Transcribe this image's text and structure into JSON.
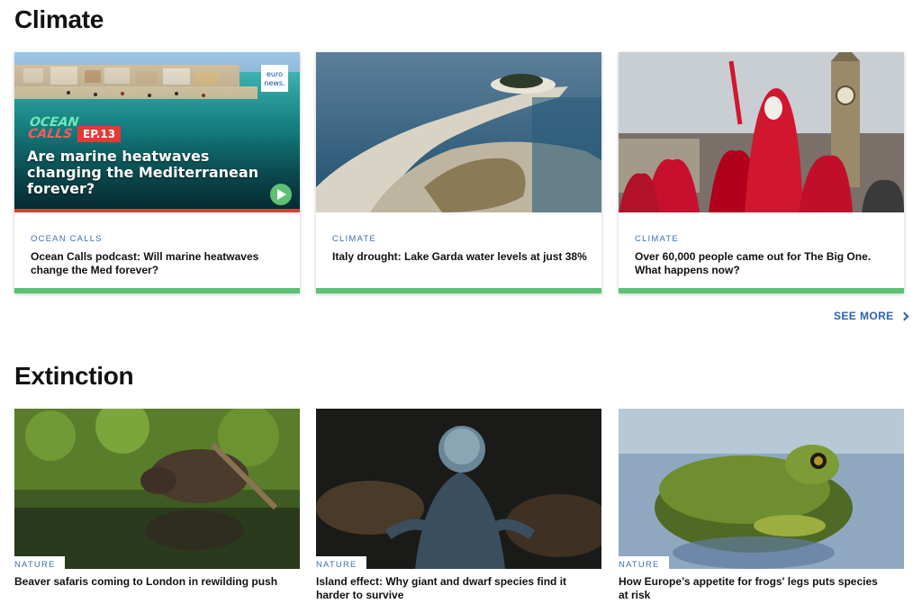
{
  "sections": {
    "climate": {
      "title": "Climate",
      "see_more": "SEE MORE",
      "cards": [
        {
          "category": "OCEAN CALLS",
          "headline": "Ocean Calls podcast: Will marine heatwaves change the Med forever?",
          "image_overlay": {
            "brand_top": "euro",
            "brand_bottom": "news.",
            "show_line1": "OCEAN",
            "show_line2": "CALLS",
            "episode": "EP.13",
            "line1": "Are marine heatwaves",
            "line2": "changing the Mediterranean",
            "line3": "forever?"
          }
        },
        {
          "category": "CLIMATE",
          "headline": "Italy drought: Lake Garda water levels at just 38%"
        },
        {
          "category": "CLIMATE",
          "headline": "Over 60,000 people came out for The Big One. What happens now?"
        }
      ]
    },
    "extinction": {
      "title": "Extinction",
      "cards": [
        {
          "category": "NATURE",
          "headline": "Beaver safaris coming to London in rewilding push"
        },
        {
          "category": "NATURE",
          "headline": "Island effect: Why giant and dwarf species find it harder to survive"
        },
        {
          "category": "NATURE",
          "headline": "How Europe’s appetite for frogs' legs puts species at risk"
        }
      ]
    }
  },
  "colors": {
    "category_blue": "#3d6fb0",
    "link_blue": "#2b63b5",
    "accent_green": "#5cc173",
    "accent_red": "#e53935"
  }
}
